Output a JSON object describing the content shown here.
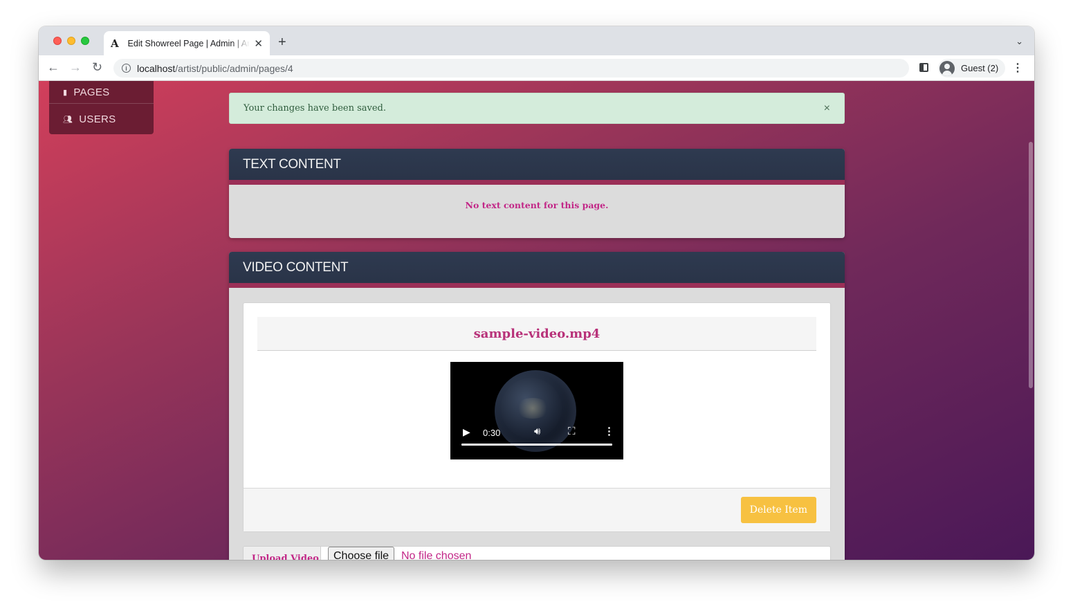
{
  "browser": {
    "tab_title": "Edit Showreel Page | Admin | Artist",
    "tab_favicon": "A",
    "new_tab": "+",
    "tab_menu": "⌄",
    "url_host": "localhost",
    "url_path": "/artist/public/admin/pages/4",
    "profile_label": "Guest (2)",
    "info": "i"
  },
  "sidebar": {
    "items": [
      {
        "label": "PAGES",
        "icon": "document-icon"
      },
      {
        "label": "USERS",
        "icon": "users-icon"
      }
    ]
  },
  "alert": {
    "message": "Your changes have been saved.",
    "close": "×"
  },
  "text_panel": {
    "title": "TEXT CONTENT",
    "empty_message": "No text content for this page."
  },
  "video_panel": {
    "title": "VIDEO CONTENT",
    "video": {
      "filename": "sample-video.mp4",
      "time": "0:30",
      "progress": 1.0
    },
    "delete_label": "Delete Item",
    "upload_label": "Upload Video",
    "choose_file_label": "Choose file",
    "file_status": "No file chosen"
  },
  "colors": {
    "accent": "#c22787",
    "panel_header": "#2e3a50",
    "delete_button": "#f7c141",
    "alert_bg": "#d4ecdb"
  }
}
